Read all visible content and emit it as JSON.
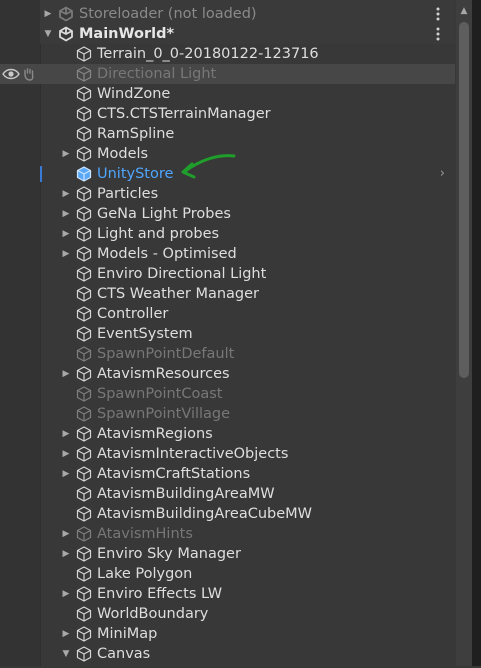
{
  "hierarchy": {
    "rows": [
      {
        "label": "Storeloader (not loaded)",
        "indent": 1,
        "arrow": "right",
        "icon": "unity-scene-icon",
        "kind": "scene-unloaded",
        "menu": true
      },
      {
        "label": "MainWorld*",
        "indent": 1,
        "arrow": "down",
        "icon": "unity-scene-icon",
        "kind": "scene",
        "menu": true
      },
      {
        "label": "Terrain_0_0-20180122-123716",
        "indent": 2,
        "arrow": "",
        "icon": "gameobject-icon",
        "kind": "normal"
      },
      {
        "label": "Directional Light",
        "indent": 2,
        "arrow": "",
        "icon": "gameobject-icon",
        "kind": "disabled",
        "hover": true
      },
      {
        "label": "WindZone",
        "indent": 2,
        "arrow": "",
        "icon": "gameobject-icon",
        "kind": "normal"
      },
      {
        "label": "CTS.CTSTerrainManager",
        "indent": 2,
        "arrow": "",
        "icon": "gameobject-icon",
        "kind": "normal"
      },
      {
        "label": "RamSpline",
        "indent": 2,
        "arrow": "",
        "icon": "gameobject-icon",
        "kind": "normal"
      },
      {
        "label": "Models",
        "indent": 2,
        "arrow": "right",
        "icon": "gameobject-icon",
        "kind": "normal"
      },
      {
        "label": "UnityStore",
        "indent": 2,
        "arrow": "",
        "icon": "prefab-icon",
        "kind": "blue",
        "selected": true
      },
      {
        "label": "Particles",
        "indent": 2,
        "arrow": "right",
        "icon": "gameobject-icon",
        "kind": "normal"
      },
      {
        "label": "GeNa Light Probes",
        "indent": 2,
        "arrow": "right",
        "icon": "gameobject-icon",
        "kind": "normal"
      },
      {
        "label": "Light and probes",
        "indent": 2,
        "arrow": "right",
        "icon": "gameobject-icon",
        "kind": "normal"
      },
      {
        "label": "Models - Optimised",
        "indent": 2,
        "arrow": "right",
        "icon": "gameobject-icon",
        "kind": "normal"
      },
      {
        "label": "Enviro Directional Light",
        "indent": 2,
        "arrow": "",
        "icon": "gameobject-icon",
        "kind": "normal"
      },
      {
        "label": "CTS Weather Manager",
        "indent": 2,
        "arrow": "",
        "icon": "gameobject-icon",
        "kind": "normal"
      },
      {
        "label": "Controller",
        "indent": 2,
        "arrow": "",
        "icon": "gameobject-icon",
        "kind": "normal"
      },
      {
        "label": "EventSystem",
        "indent": 2,
        "arrow": "",
        "icon": "gameobject-icon",
        "kind": "normal"
      },
      {
        "label": "SpawnPointDefault",
        "indent": 2,
        "arrow": "",
        "icon": "gameobject-icon",
        "kind": "disabled"
      },
      {
        "label": "AtavismResources",
        "indent": 2,
        "arrow": "right",
        "icon": "gameobject-icon",
        "kind": "normal"
      },
      {
        "label": "SpawnPointCoast",
        "indent": 2,
        "arrow": "",
        "icon": "gameobject-icon",
        "kind": "disabled"
      },
      {
        "label": "SpawnPointVillage",
        "indent": 2,
        "arrow": "",
        "icon": "gameobject-icon",
        "kind": "disabled"
      },
      {
        "label": "AtavismRegions",
        "indent": 2,
        "arrow": "right",
        "icon": "gameobject-icon",
        "kind": "normal"
      },
      {
        "label": "AtavismInteractiveObjects",
        "indent": 2,
        "arrow": "right",
        "icon": "gameobject-icon",
        "kind": "normal"
      },
      {
        "label": "AtavismCraftStations",
        "indent": 2,
        "arrow": "right",
        "icon": "gameobject-icon",
        "kind": "normal"
      },
      {
        "label": "AtavismBuildingAreaMW",
        "indent": 2,
        "arrow": "",
        "icon": "gameobject-icon",
        "kind": "normal"
      },
      {
        "label": "AtavismBuildingAreaCubeMW",
        "indent": 2,
        "arrow": "",
        "icon": "gameobject-icon",
        "kind": "normal"
      },
      {
        "label": "AtavismHints",
        "indent": 2,
        "arrow": "right",
        "icon": "gameobject-icon",
        "kind": "disabled"
      },
      {
        "label": "Enviro Sky Manager",
        "indent": 2,
        "arrow": "right",
        "icon": "gameobject-icon",
        "kind": "normal"
      },
      {
        "label": "Lake Polygon",
        "indent": 2,
        "arrow": "",
        "icon": "gameobject-icon",
        "kind": "normal"
      },
      {
        "label": "Enviro Effects LW",
        "indent": 2,
        "arrow": "right",
        "icon": "gameobject-icon",
        "kind": "normal"
      },
      {
        "label": "WorldBoundary",
        "indent": 2,
        "arrow": "",
        "icon": "gameobject-icon",
        "kind": "normal"
      },
      {
        "label": "MiniMap",
        "indent": 2,
        "arrow": "right",
        "icon": "gameobject-icon",
        "kind": "normal"
      },
      {
        "label": "Canvas",
        "indent": 2,
        "arrow": "down",
        "icon": "gameobject-icon",
        "kind": "normal"
      }
    ]
  },
  "icons": {
    "visibility": "eye-icon",
    "picking": "hand-pointer-icon",
    "context_menu": "vertical-dots-icon",
    "expand_child": "chevron-right-icon",
    "scroll_up": "triangle-up-icon",
    "annotation": "green-arrow-icon"
  },
  "colors": {
    "background": "#383838",
    "text": "#dedede",
    "disabled_text": "#777777",
    "prefab_text": "#4ea6ff",
    "annotation_arrow": "#1f9e2c",
    "selection_bar": "#3a79d6"
  },
  "scrollbar": {
    "position_fraction": 0.0,
    "thumb_fraction": 0.53
  }
}
